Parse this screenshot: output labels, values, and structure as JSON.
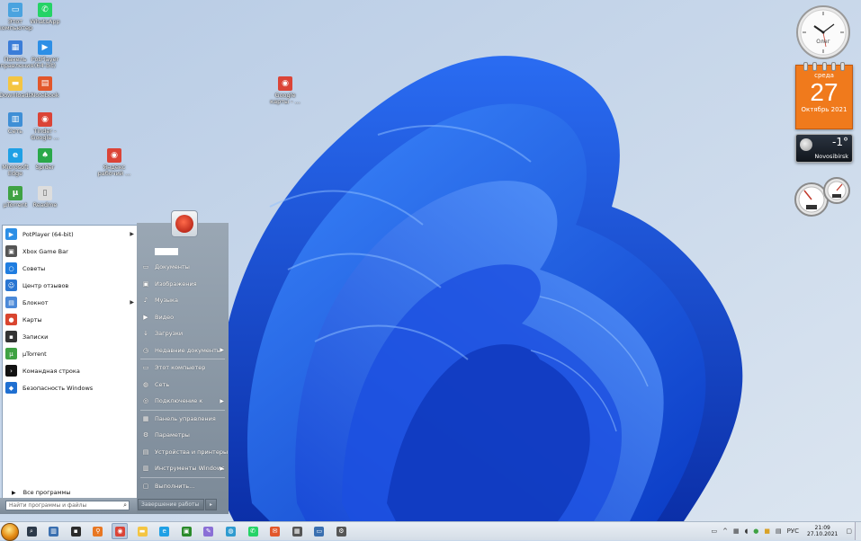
{
  "desktop": {
    "icons": [
      {
        "label": "Этот компьютер",
        "icon": "computer-icon",
        "color": "#4aa3df"
      },
      {
        "label": "WhatsApp",
        "icon": "whatsapp-icon",
        "color": "#25d366"
      },
      {
        "label": "Панель управления",
        "icon": "control-panel-icon",
        "color": "#3b7dd8"
      },
      {
        "label": "PotPlayer (64-bit)",
        "icon": "potplayer-icon",
        "color": "#2d8fe6"
      },
      {
        "label": "Downloads",
        "icon": "folder-icon",
        "color": "#f4c542"
      },
      {
        "label": "Notebook",
        "icon": "notebook-icon",
        "color": "#e2572b"
      },
      {
        "label": "Google карты - ...",
        "icon": "chrome-icon",
        "color": "#db4437"
      },
      {
        "label": "Сеть",
        "icon": "network-icon",
        "color": "#3f8fd6"
      },
      {
        "label": "Tinder - Google ...",
        "icon": "chrome-icon",
        "color": "#db4437"
      },
      {
        "label": "Microsoft Edge",
        "icon": "edge-icon",
        "color": "#1fa0e5"
      },
      {
        "label": "Spider",
        "icon": "spider-icon",
        "color": "#2aa84a"
      },
      {
        "label": "Яндекс рабочий ...",
        "icon": "chrome-icon",
        "color": "#db4437"
      },
      {
        "label": "µTorrent",
        "icon": "utorrent-icon",
        "color": "#3fa243"
      },
      {
        "label": "Readme",
        "icon": "document-icon",
        "color": "#dddddd"
      }
    ]
  },
  "gadgets": {
    "clock": {
      "label": "Олег"
    },
    "calendar": {
      "weekday": "среда",
      "day": "27",
      "month_year": "Октябрь 2021"
    },
    "weather": {
      "temperature": "-1°",
      "city": "Novosibirsk"
    }
  },
  "start_menu": {
    "user_avatar_icon": "user-emblem-icon",
    "programs": [
      {
        "label": "PotPlayer (64-bit)",
        "icon": "potplayer-icon",
        "color": "#2d8fe6",
        "has_submenu": true
      },
      {
        "label": "Xbox Game Bar",
        "icon": "xbox-icon",
        "color": "#555555",
        "has_submenu": false
      },
      {
        "label": "Советы",
        "icon": "tips-icon",
        "color": "#1f7de0",
        "has_submenu": false
      },
      {
        "label": "Центр отзывов",
        "icon": "feedback-icon",
        "color": "#2a76d2",
        "has_submenu": false
      },
      {
        "label": "Блокнот",
        "icon": "notepad-icon",
        "color": "#4b89d8",
        "has_submenu": true
      },
      {
        "label": "Карты",
        "icon": "maps-icon",
        "color": "#d9452f",
        "has_submenu": false
      },
      {
        "label": "Записки",
        "icon": "sticky-notes-icon",
        "color": "#333333",
        "has_submenu": false
      },
      {
        "label": "µTorrent",
        "icon": "utorrent-icon",
        "color": "#3fa243",
        "has_submenu": false
      },
      {
        "label": "Командная строка",
        "icon": "cmd-icon",
        "color": "#111111",
        "has_submenu": false
      },
      {
        "label": "Безопасность Windows",
        "icon": "shield-icon",
        "color": "#1f6fd1",
        "has_submenu": false
      }
    ],
    "all_programs_label": "Все программы",
    "search_placeholder": "Найти программы и файлы",
    "right_items": [
      {
        "label": "Документы",
        "icon": "documents-icon",
        "has_submenu": false,
        "sep_before": false
      },
      {
        "label": "Изображения",
        "icon": "pictures-icon",
        "has_submenu": false,
        "sep_before": false
      },
      {
        "label": "Музыка",
        "icon": "music-icon",
        "has_submenu": false,
        "sep_before": false
      },
      {
        "label": "Видео",
        "icon": "video-icon",
        "has_submenu": false,
        "sep_before": false
      },
      {
        "label": "Загрузки",
        "icon": "downloads-icon",
        "has_submenu": false,
        "sep_before": false
      },
      {
        "label": "Недавние документы",
        "icon": "recent-icon",
        "has_submenu": true,
        "sep_before": false
      },
      {
        "label": "Этот компьютер",
        "icon": "computer-icon",
        "has_submenu": false,
        "sep_before": true
      },
      {
        "label": "Сеть",
        "icon": "network-icon",
        "has_submenu": false,
        "sep_before": false
      },
      {
        "label": "Подключение к",
        "icon": "connect-icon",
        "has_submenu": true,
        "sep_before": false
      },
      {
        "label": "Панель управления",
        "icon": "control-panel-icon",
        "has_submenu": false,
        "sep_before": true
      },
      {
        "label": "Параметры",
        "icon": "gear-icon",
        "has_submenu": false,
        "sep_before": false
      },
      {
        "label": "Устройства и принтеры",
        "icon": "printer-icon",
        "has_submenu": false,
        "sep_before": false
      },
      {
        "label": "Инструменты Windows",
        "icon": "tools-icon",
        "has_submenu": true,
        "sep_before": false
      },
      {
        "label": "Выполнить...",
        "icon": "run-icon",
        "has_submenu": false,
        "sep_before": true
      }
    ],
    "shutdown_label": "Завершение работы"
  },
  "taskbar": {
    "pinned": [
      {
        "icon": "search-icon",
        "color": "#2d3a4a",
        "active": false
      },
      {
        "icon": "task-view-icon",
        "color": "#3a6fb0",
        "active": false
      },
      {
        "icon": "widgets-icon",
        "color": "#2b2b2b",
        "active": false
      },
      {
        "icon": "magnifier-tool-icon",
        "color": "#e87722",
        "active": false
      },
      {
        "icon": "chrome-icon",
        "color": "#db4437",
        "active": true
      },
      {
        "icon": "explorer-icon",
        "color": "#f4c542",
        "active": false
      },
      {
        "icon": "edge-icon",
        "color": "#1fa0e5",
        "active": false
      },
      {
        "icon": "xbox-icon",
        "color": "#2a8a2a",
        "active": false
      },
      {
        "icon": "paint-icon",
        "color": "#8a6fd6",
        "active": false
      },
      {
        "icon": "network-globe-icon",
        "color": "#2f9bd0",
        "active": false
      },
      {
        "icon": "whatsapp-icon",
        "color": "#25d366",
        "active": false
      },
      {
        "icon": "mail-icon",
        "color": "#e2572b",
        "active": false
      },
      {
        "icon": "calculator-icon",
        "color": "#555555",
        "active": false
      },
      {
        "icon": "remote-desktop-icon",
        "color": "#3a6fb0",
        "active": false
      },
      {
        "icon": "settings-icon",
        "color": "#555555",
        "active": false
      }
    ],
    "tray": {
      "language": "РУС",
      "time": "21:09",
      "date": "27.10.2021"
    }
  }
}
